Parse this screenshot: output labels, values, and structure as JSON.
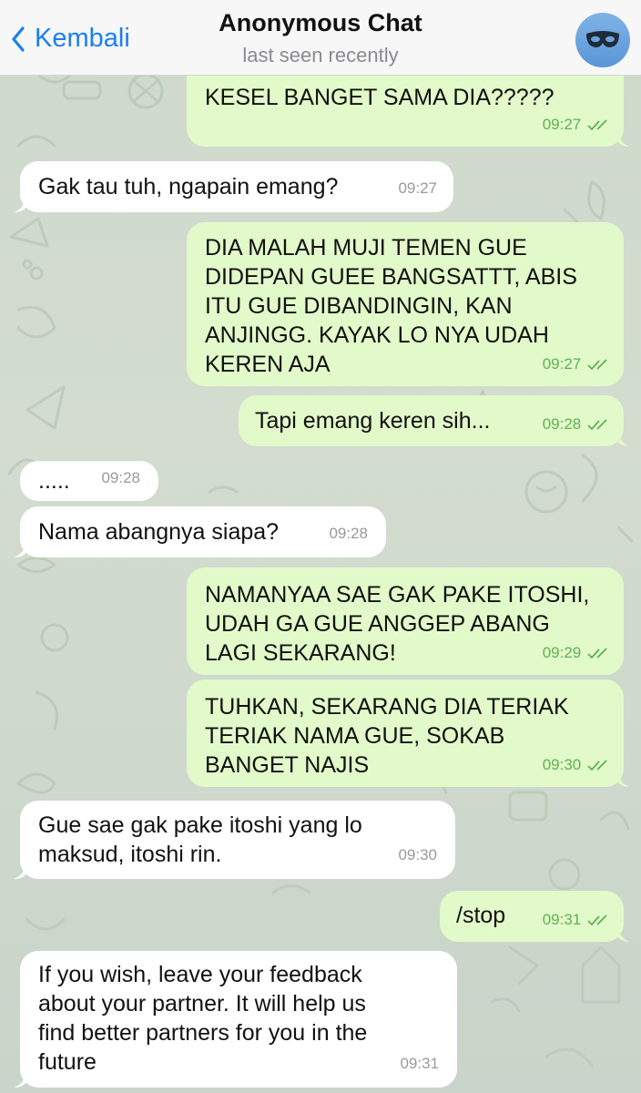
{
  "header": {
    "back_label": "Kembali",
    "title": "Anonymous Chat",
    "status": "last seen recently"
  },
  "messages": [
    {
      "dir": "out",
      "text": "GUE NGAPAIN SAMPE GUEEE\nKESEL BANGET SAMA DIA?????",
      "time": "09:27"
    },
    {
      "dir": "in",
      "text": "Gak tau tuh, ngapain emang?",
      "time": "09:27"
    },
    {
      "dir": "out",
      "text": "DIA MALAH MUJI TEMEN GUE\nDIDEPAN GUEE BANGSATTT, ABIS\nITU GUE DIBANDINGIN, KAN\nANJINGG. KAYAK LO NYA UDAH\nKEREN AJA",
      "time": "09:27"
    },
    {
      "dir": "out",
      "text": "Tapi emang keren sih...",
      "time": "09:28"
    },
    {
      "dir": "in",
      "text": ".....",
      "time": "09:28"
    },
    {
      "dir": "in",
      "text": "Nama abangnya siapa?",
      "time": "09:28"
    },
    {
      "dir": "out",
      "text": "NAMANYAA SAE GAK PAKE ITOSHI,\nUDAH GA GUE ANGGEP ABANG\nLAGI SEKARANG!",
      "time": "09:29"
    },
    {
      "dir": "out",
      "text": "TUHKAN, SEKARANG DIA TERIAK\nTERIAK NAMA GUE, SOKAB\nBANGET NAJIS",
      "time": "09:30"
    },
    {
      "dir": "in",
      "text": "Gue sae gak pake itoshi yang lo\nmaksud, itoshi rin.",
      "time": "09:30"
    },
    {
      "dir": "out",
      "text": "/stop",
      "time": "09:31"
    },
    {
      "dir": "in",
      "text": "If you wish, leave your feedback\nabout your partner. It will help us\nfind better partners for you in the\nfuture",
      "time": "09:31"
    }
  ],
  "colors": {
    "incoming": "#ffffff",
    "outgoing": "#e2f9c9",
    "accent": "#1a7ff2",
    "read_check": "#5fb154"
  },
  "icons": {
    "back": "chevron-left-icon",
    "avatar": "mask-icon",
    "read": "double-check-icon"
  }
}
